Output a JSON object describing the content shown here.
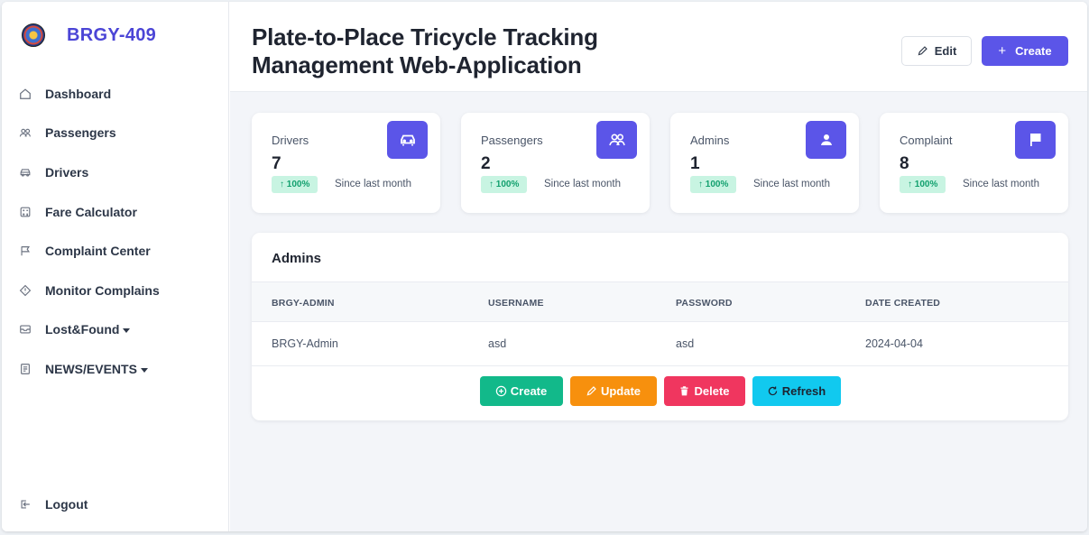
{
  "brand": {
    "name": "BRGY-409"
  },
  "sidebar": {
    "items": [
      {
        "label": "Dashboard",
        "icon": "home-icon",
        "dropdown": false
      },
      {
        "label": "Passengers",
        "icon": "users-icon",
        "dropdown": false
      },
      {
        "label": "Drivers",
        "icon": "car-icon",
        "dropdown": false
      },
      {
        "label": "Fare Calculator",
        "icon": "calculator-icon",
        "dropdown": false
      },
      {
        "label": "Complaint Center",
        "icon": "flag-icon",
        "dropdown": false
      },
      {
        "label": "Monitor Complains",
        "icon": "diamond-alert-icon",
        "dropdown": false
      },
      {
        "label": "Lost&Found",
        "icon": "inbox-icon",
        "dropdown": true
      },
      {
        "label": "NEWS/EVENTS",
        "icon": "document-icon",
        "dropdown": true
      }
    ],
    "logout": {
      "label": "Logout",
      "icon": "logout-icon"
    }
  },
  "header": {
    "title_line1": "Plate-to-Place Tricycle Tracking",
    "title_line2": "Management Web-Application",
    "edit_label": "Edit",
    "create_label": "Create"
  },
  "stats": [
    {
      "label": "Drivers",
      "value": "7",
      "badge": "↑ 100%",
      "since": "Since last month",
      "icon": "car-icon"
    },
    {
      "label": "Passengers",
      "value": "2",
      "badge": "↑ 100%",
      "since": "Since last month",
      "icon": "users-icon"
    },
    {
      "label": "Admins",
      "value": "1",
      "badge": "↑ 100%",
      "since": "Since last month",
      "icon": "user-icon"
    },
    {
      "label": "Complaint",
      "value": "8",
      "badge": "↑ 100%",
      "since": "Since last month",
      "icon": "flag-icon"
    }
  ],
  "admins_panel": {
    "title": "Admins",
    "columns": [
      "BRGY-ADMIN",
      "USERNAME",
      "PASSWORD",
      "DATE CREATED"
    ],
    "rows": [
      [
        "BRGY-Admin",
        "asd",
        "asd",
        "2024-04-04"
      ]
    ],
    "actions": {
      "create": "Create",
      "update": "Update",
      "delete": "Delete",
      "refresh": "Refresh"
    }
  },
  "colors": {
    "accent": "#5b55e8",
    "brand_text": "#4b45d6",
    "create": "#12b98a",
    "update": "#f7900d",
    "delete": "#f0365f",
    "refresh": "#11c9ef",
    "badge_bg": "#c8f4e2",
    "badge_text": "#12a06e"
  }
}
